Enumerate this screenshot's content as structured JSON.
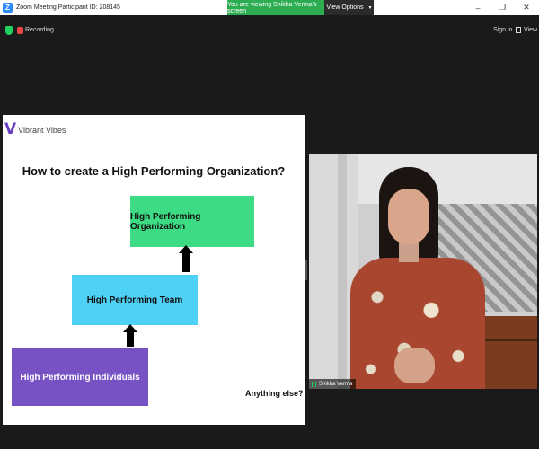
{
  "window": {
    "title": "Zoom Meeting Participant ID: 208145",
    "controls": {
      "minimize_glyph": "–",
      "maximize_glyph": "❐",
      "close_glyph": "✕"
    }
  },
  "banner": {
    "viewing_text": "You are viewing Shikha Verma's screen",
    "view_options_label": "View Options",
    "caret_glyph": "▾"
  },
  "toolbar": {
    "recording_label": "Recording",
    "sign_in_label": "Sign in",
    "view_label": "View"
  },
  "slide": {
    "brand_mark": "V",
    "brand_name": "Vibrant Vibes",
    "title": "How to create a High Performing Organization?",
    "box_organization": "High Performing Organization",
    "box_team": "High Performing Team",
    "box_individuals": "High Performing Individuals",
    "question": "Anything else?"
  },
  "video": {
    "participant_name": "Shikha Verma"
  },
  "colors": {
    "banner_green": "#2dad52",
    "box_organization": "#3ddc84",
    "box_team": "#4fd0f5",
    "box_individuals": "#7752c4",
    "brand_purple": "#6a3fc1",
    "recording_red": "#e84545"
  },
  "icons": [
    "zoom-logo-icon",
    "shield-icon",
    "recording-icon",
    "view-icon",
    "mic-icon",
    "minimize-icon",
    "maximize-icon",
    "close-icon"
  ]
}
